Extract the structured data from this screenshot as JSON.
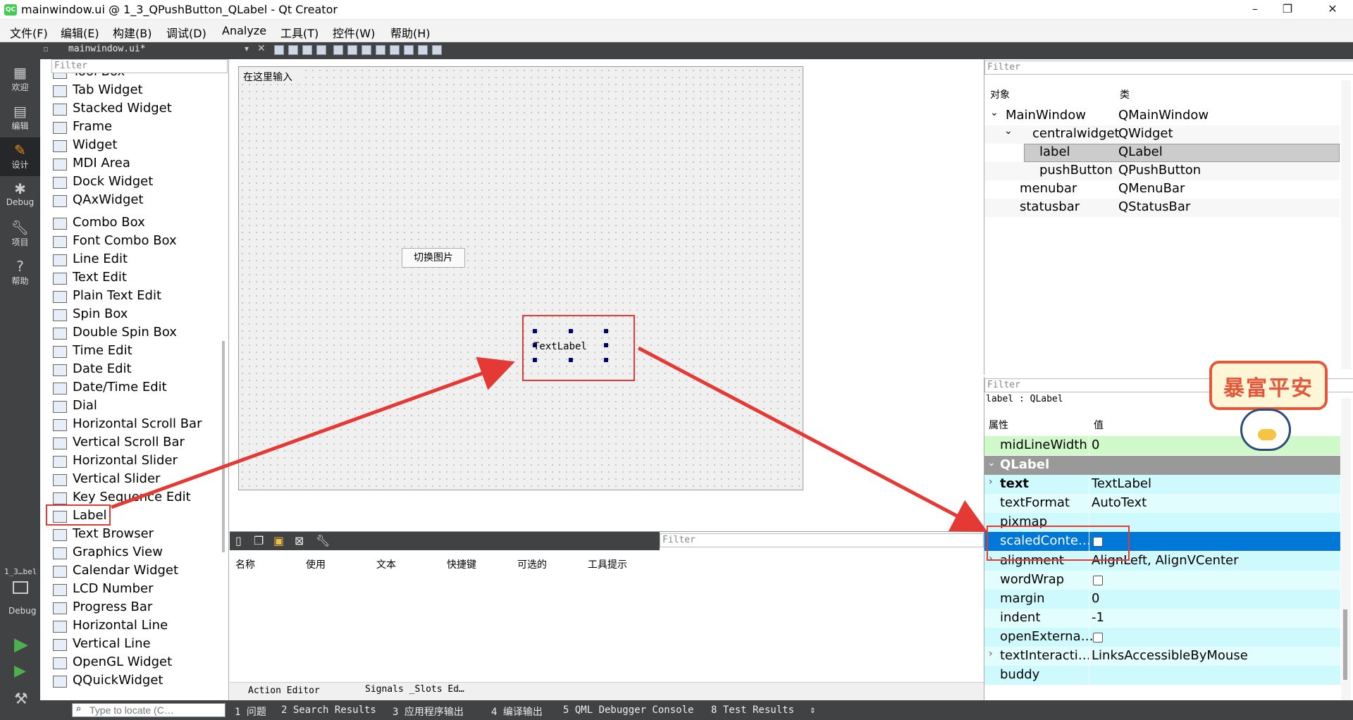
{
  "window": {
    "title": "mainwindow.ui @ 1_3_QPushButton_QLabel - Qt Creator",
    "logo": "QC",
    "minimize": "–",
    "maximize": "❐",
    "close": "✕"
  },
  "menu": [
    "文件(F)",
    "编辑(E)",
    "构建(B)",
    "调试(D)",
    "Analyze",
    "工具(T)",
    "控件(W)",
    "帮助(H)"
  ],
  "modes": [
    {
      "label": "欢迎",
      "icon": "grid-icon"
    },
    {
      "label": "编辑",
      "icon": "document-icon"
    },
    {
      "label": "设计",
      "icon": "pencil-icon"
    },
    {
      "label": "Debug",
      "icon": "bug-icon"
    },
    {
      "label": "项目",
      "icon": "wrench-icon"
    },
    {
      "label": "帮助",
      "icon": "help-icon"
    }
  ],
  "kit": {
    "project": "1_3…bel",
    "mode": "Debug"
  },
  "editor_tab": "mainwindow.ui*",
  "widgetbox": {
    "filter": "Filter",
    "items": [
      "Tool Box",
      "Tab Widget",
      "Stacked Widget",
      "Frame",
      "Widget",
      "MDI Area",
      "Dock Widget",
      "QAxWidget",
      "Combo Box",
      "Font Combo Box",
      "Line Edit",
      "Text Edit",
      "Plain Text Edit",
      "Spin Box",
      "Double Spin Box",
      "Time Edit",
      "Date Edit",
      "Date/Time Edit",
      "Dial",
      "Horizontal Scroll Bar",
      "Vertical Scroll Bar",
      "Horizontal Slider",
      "Vertical Slider",
      "Key Sequence Edit",
      "Label",
      "Text Browser",
      "Graphics View",
      "Calendar Widget",
      "LCD Number",
      "Progress Bar",
      "Horizontal Line",
      "Vertical Line",
      "OpenGL Widget",
      "QQuickWidget"
    ]
  },
  "form": {
    "menu_placeholder": "在这里输入",
    "button": "切换图片",
    "label": "TextLabel"
  },
  "signal_slot": {
    "filter": "Filter",
    "columns": [
      "名称",
      "使用",
      "文本",
      "快捷键",
      "可选的",
      "工具提示"
    ],
    "tabs": [
      "Action Editor",
      "Signals _Slots Ed…"
    ]
  },
  "object_inspector": {
    "filter": "Filter",
    "col_object": "对象",
    "col_class": "类",
    "rows": [
      {
        "name": "MainWindow",
        "cls": "QMainWindow",
        "indent": 0,
        "expand": "⌄"
      },
      {
        "name": "centralwidget",
        "cls": "QWidget",
        "indent": 1,
        "expand": "⌄"
      },
      {
        "name": "label",
        "cls": "QLabel",
        "indent": 2,
        "expand": ""
      },
      {
        "name": "pushButton",
        "cls": "QPushButton",
        "indent": 2,
        "expand": ""
      },
      {
        "name": "menubar",
        "cls": "QMenuBar",
        "indent": 1,
        "expand": ""
      },
      {
        "name": "statusbar",
        "cls": "QStatusBar",
        "indent": 1,
        "expand": ""
      }
    ]
  },
  "property_editor": {
    "filter": "Filter",
    "object": "label : QLabel",
    "col_prop": "属性",
    "col_value": "值",
    "section": "QLabel",
    "rows": [
      {
        "name": "midLineWidth",
        "value": "0"
      },
      {
        "name": "text",
        "value": "TextLabel"
      },
      {
        "name": "textFormat",
        "value": "AutoText"
      },
      {
        "name": "pixmap",
        "value": ""
      },
      {
        "name": "scaledConte…",
        "value": ""
      },
      {
        "name": "alignment",
        "value": "AlignLeft, AlignVCenter"
      },
      {
        "name": "wordWrap",
        "value": ""
      },
      {
        "name": "margin",
        "value": "0"
      },
      {
        "name": "indent",
        "value": "-1"
      },
      {
        "name": "openExterna…",
        "value": ""
      },
      {
        "name": "textInteracti…",
        "value": "LinksAccessibleByMouse"
      },
      {
        "name": "buddy",
        "value": ""
      }
    ]
  },
  "sticker": {
    "text": "暴富平安"
  },
  "statusbar": {
    "locate": "Type to locate (C…",
    "items": [
      "1 问题",
      "2 Search Results",
      "3 应用程序输出",
      "4 编译输出",
      "5 QML Debugger Console",
      "8 Test Results"
    ]
  },
  "colors": {
    "highlight": "#0078d7",
    "selected_row": "#cccccc",
    "qlabel_section": "#999999",
    "prop_cyan": "#cefafe",
    "prop_cyan2": "#e1fdfe",
    "prop_green": "#cff9c8",
    "annotation": "#e53935",
    "dark_panel": "#404244"
  }
}
